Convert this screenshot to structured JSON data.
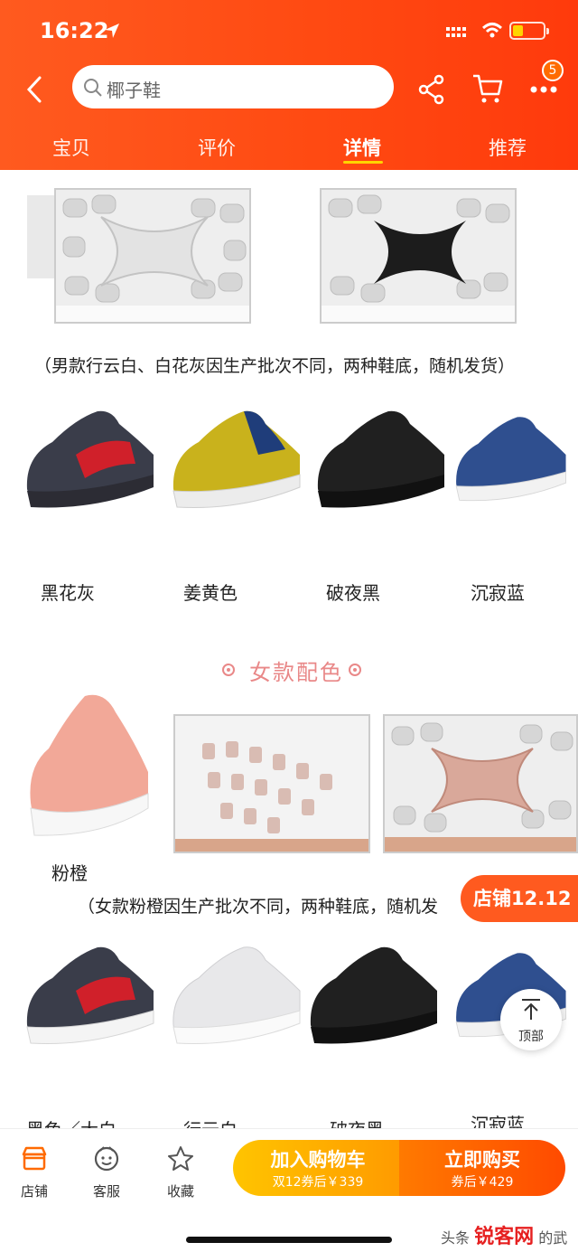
{
  "status_bar": {
    "time": "16:22"
  },
  "header": {
    "search_placeholder": "椰子鞋",
    "cart_badge": "5",
    "tabs": [
      {
        "label": "宝贝"
      },
      {
        "label": "评价"
      },
      {
        "label": "详情"
      },
      {
        "label": "推荐"
      }
    ],
    "active_tab": "详情"
  },
  "content": {
    "men_note": "（男款行云白、白花灰因生产批次不同，两种鞋底，随机发货）",
    "men_colors": [
      {
        "label": "黑花灰"
      },
      {
        "label": "姜黄色"
      },
      {
        "label": "破夜黑"
      },
      {
        "label": "沉寂蓝"
      }
    ],
    "women_section_title": "女款配色",
    "women_first_color": "粉橙",
    "women_note": "（女款粉橙因生产批次不同，两种鞋底，随机发",
    "women_colors": [
      {
        "label": "黑色／大白"
      },
      {
        "label": "行云白"
      },
      {
        "label": "破夜黑"
      },
      {
        "label": "沉寂蓝"
      }
    ],
    "store_promo": "店铺12.12",
    "back_to_top": "顶部"
  },
  "bottom_bar": {
    "store": "店铺",
    "service": "客服",
    "favorite": "收藏",
    "add_cart": "加入购物车",
    "add_cart_sub": "双12券后￥339",
    "buy_now": "立即购买",
    "buy_now_sub": "券后￥429"
  },
  "watermark": {
    "prefix": "头条",
    "brand": "锐客网",
    "suffix": "的武"
  },
  "colors": {
    "header": "#ff4a12",
    "accent_yellow": "#ffd400",
    "cart_button": "#ffb000",
    "buy_button": "#ff5a00",
    "section_pink": "#e98888"
  }
}
